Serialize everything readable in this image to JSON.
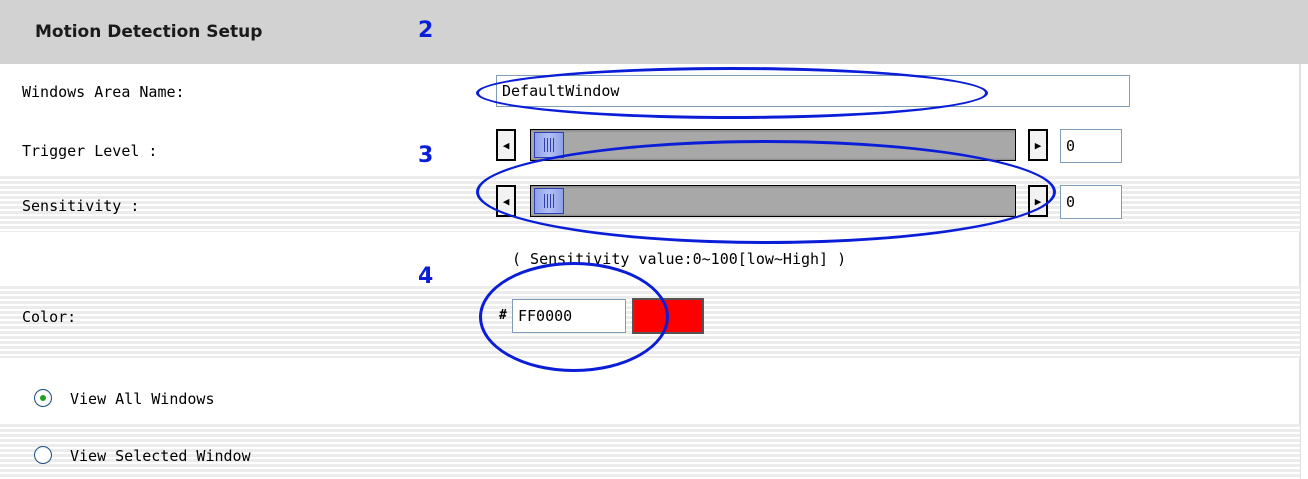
{
  "header": {
    "title": "Motion Detection Setup"
  },
  "markers": [
    "2",
    "3",
    "4"
  ],
  "form": {
    "window_name": {
      "label": "Windows Area Name:",
      "value": "DefaultWindow"
    },
    "trigger_level": {
      "label": "Trigger Level :",
      "value": "0",
      "slider_fraction": 0
    },
    "sensitivity": {
      "label": "Sensitivity :",
      "value": "0",
      "slider_fraction": 0
    },
    "sensitivity_hint": "( Sensitivity value:0~100[low~High] )",
    "color": {
      "label": "Color:",
      "hash_prefix": "#",
      "value": "FF0000",
      "swatch_hex": "#ff0000"
    },
    "view_options": [
      {
        "label": "View All Windows",
        "selected": true
      },
      {
        "label": "View Selected Window",
        "selected": false
      }
    ]
  },
  "colors": {
    "header_bg": "#d2d2d2",
    "annotation": "#0a1ed8",
    "slider_thumb": "#8fa0e8"
  }
}
